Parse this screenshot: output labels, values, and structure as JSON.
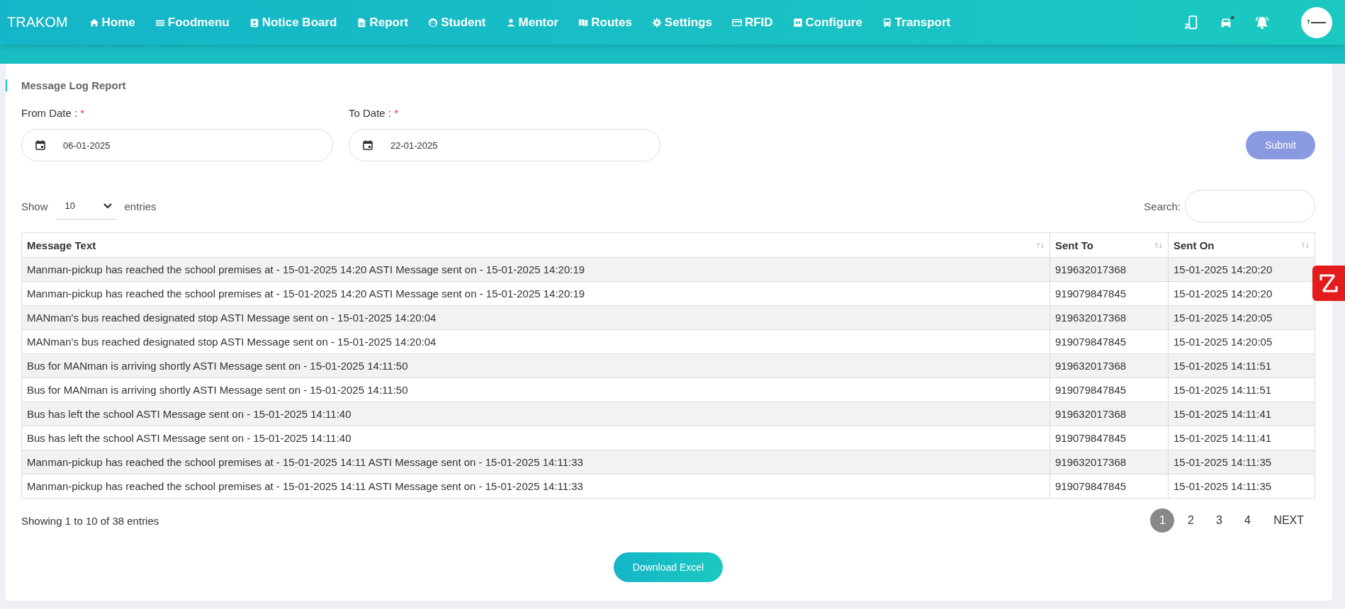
{
  "brand": "TRAKOM",
  "nav": [
    {
      "label": "Home"
    },
    {
      "label": "Foodmenu"
    },
    {
      "label": "Notice Board"
    },
    {
      "label": "Report"
    },
    {
      "label": "Student"
    },
    {
      "label": "Mentor"
    },
    {
      "label": "Routes"
    },
    {
      "label": "Settings"
    },
    {
      "label": "RFID"
    },
    {
      "label": "Configure"
    },
    {
      "label": "Transport"
    }
  ],
  "card_title": "Message Log Report",
  "from_date": {
    "label": "From Date :",
    "required_mark": "*",
    "value": "06-01-2025"
  },
  "to_date": {
    "label": "To Date :",
    "required_mark": "*",
    "value": "22-01-2025"
  },
  "submit": "Submit",
  "show_label": "Show",
  "page_size": "10",
  "entries_label": "entries",
  "search_label": "Search:",
  "table": {
    "columns": [
      "Message Text",
      "Sent To",
      "Sent On"
    ],
    "rows": [
      [
        "Manman-pickup has reached the school premises at - 15-01-2025 14:20 ASTI Message sent on - 15-01-2025 14:20:19",
        "919632017368",
        "15-01-2025 14:20:20"
      ],
      [
        "Manman-pickup has reached the school premises at - 15-01-2025 14:20 ASTI Message sent on - 15-01-2025 14:20:19",
        "919079847845",
        "15-01-2025 14:20:20"
      ],
      [
        "MANman's bus reached designated stop ASTI Message sent on - 15-01-2025 14:20:04",
        "919632017368",
        "15-01-2025 14:20:05"
      ],
      [
        "MANman's bus reached designated stop ASTI Message sent on - 15-01-2025 14:20:04",
        "919079847845",
        "15-01-2025 14:20:05"
      ],
      [
        "Bus for MANman is arriving shortly ASTI Message sent on - 15-01-2025 14:11:50",
        "919632017368",
        "15-01-2025 14:11:51"
      ],
      [
        "Bus for MANman is arriving shortly ASTI Message sent on - 15-01-2025 14:11:50",
        "919079847845",
        "15-01-2025 14:11:51"
      ],
      [
        "Bus has left the school ASTI Message sent on - 15-01-2025 14:11:40",
        "919632017368",
        "15-01-2025 14:11:41"
      ],
      [
        "Bus has left the school ASTI Message sent on - 15-01-2025 14:11:40",
        "919079847845",
        "15-01-2025 14:11:41"
      ],
      [
        "Manman-pickup has reached the school premises at - 15-01-2025 14:11 ASTI Message sent on - 15-01-2025 14:11:33",
        "919632017368",
        "15-01-2025 14:11:35"
      ],
      [
        "Manman-pickup has reached the school premises at - 15-01-2025 14:11 ASTI Message sent on - 15-01-2025 14:11:33",
        "919079847845",
        "15-01-2025 14:11:35"
      ]
    ]
  },
  "info": "Showing 1 to 10 of 38 entries",
  "pages": [
    {
      "label": "1",
      "selected": true
    },
    {
      "label": "2",
      "selected": false
    },
    {
      "label": "3",
      "selected": false
    },
    {
      "label": "4",
      "selected": false
    }
  ],
  "next": "NEXT",
  "download": "Download Excel"
}
